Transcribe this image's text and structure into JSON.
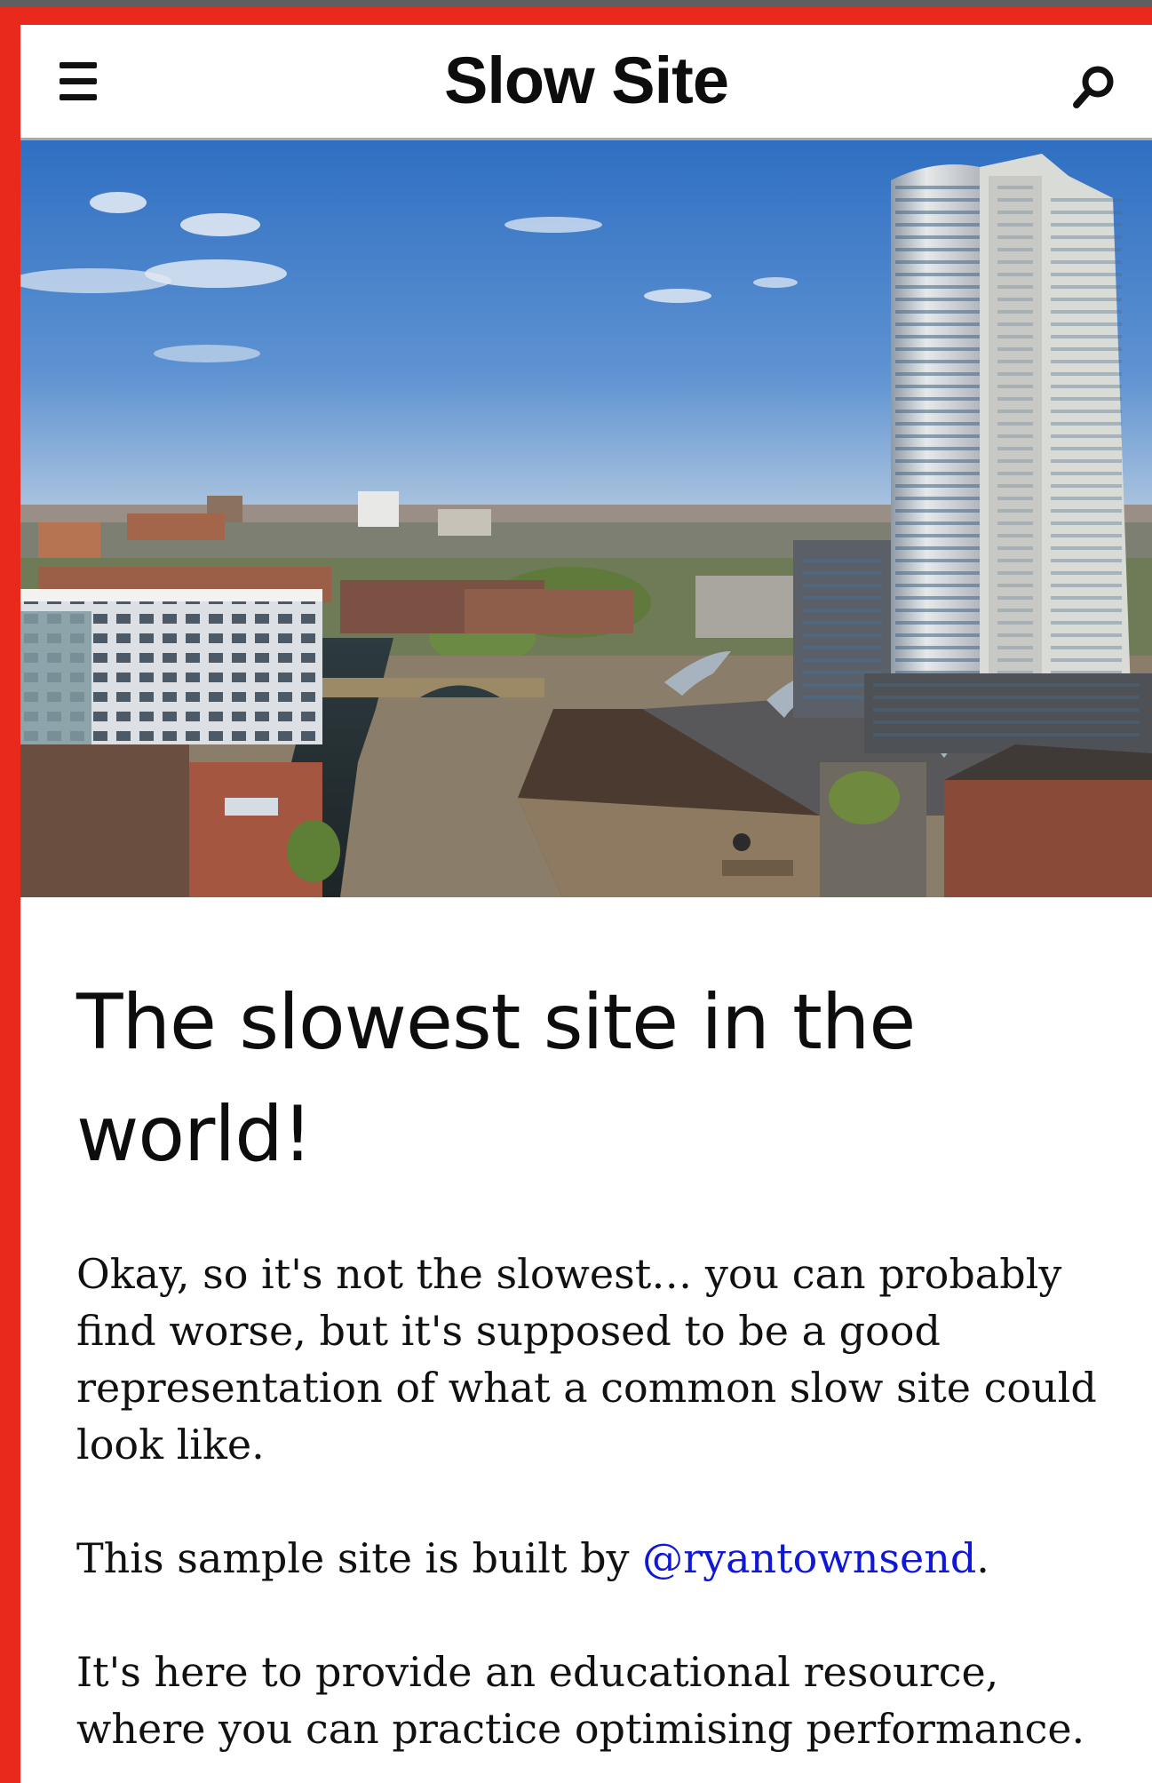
{
  "header": {
    "title": "Slow Site",
    "menu_icon": "hamburger-menu-icon",
    "search_icon": "search-icon"
  },
  "hero": {
    "image": "city-skyline-photo"
  },
  "article": {
    "headline": "The slowest site in the world!",
    "paragraph1_pre": "Okay, so it's not ",
    "paragraph1_emphasis": "the",
    "paragraph1_post": " slowest… you can probably find worse, but it's supposed to be a good representation of what a common slow site could look like.",
    "paragraph2_pre": "This sample site is built by ",
    "paragraph2_link": "@ryantownsend",
    "paragraph2_post": ".",
    "paragraph3": "It's here to provide an educational resource, where you can practice optimising performance."
  },
  "colors": {
    "frame_border": "#e8291b",
    "link": "#1018d8",
    "text": "#0d0d0d"
  }
}
